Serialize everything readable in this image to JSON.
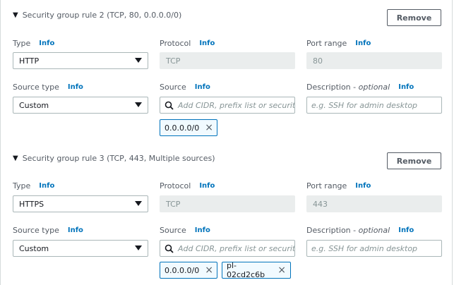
{
  "labels": {
    "type": "Type",
    "protocol": "Protocol",
    "port_range": "Port range",
    "source_type": "Source type",
    "source": "Source",
    "description": "Description",
    "optional": "optional",
    "info": "Info",
    "remove": "Remove",
    "remove_token": "×"
  },
  "rules": [
    {
      "title": "Security group rule 2 (TCP, 80, 0.0.0.0/0)",
      "type": "HTTP",
      "protocol": "TCP",
      "port_range": "80",
      "source_type": "Custom",
      "source_placeholder": "Add CIDR, prefix list or security group",
      "description_placeholder": "e.g. SSH for admin desktop",
      "sources": [
        "0.0.0.0/0"
      ]
    },
    {
      "title": "Security group rule 3 (TCP, 443, Multiple sources)",
      "type": "HTTPS",
      "protocol": "TCP",
      "port_range": "443",
      "source_type": "Custom",
      "source_placeholder": "Add CIDR, prefix list or security group",
      "description_placeholder": "e.g. SSH for admin desktop",
      "sources": [
        "0.0.0.0/0",
        "pl-02cd2c6b"
      ]
    }
  ],
  "icons": {
    "collapse": "caret-down-icon",
    "dropdown": "chevron-down-icon",
    "search": "search-icon",
    "remove": "close-icon"
  }
}
